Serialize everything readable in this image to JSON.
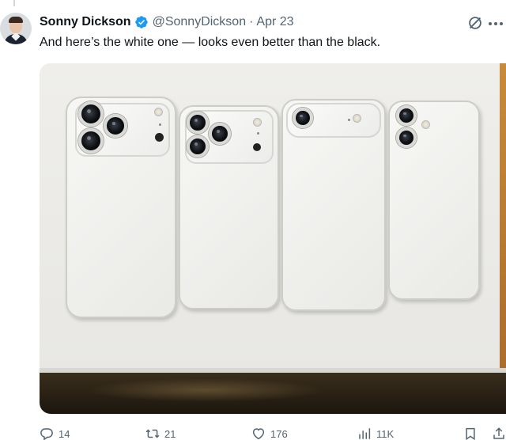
{
  "author": {
    "display_name": "Sonny Dickson",
    "handle": "@SonnyDickson",
    "separator": "·",
    "date": "Apr 23",
    "verified": true
  },
  "tweet": {
    "text": "And here’s the white one — looks even better than the black."
  },
  "media": {
    "image_description_icon": "photo-of-four-white-phone-dummies"
  },
  "actions": {
    "replies": "14",
    "reposts": "21",
    "likes": "176",
    "views": "11K"
  },
  "icons": {
    "grok": "grok-icon",
    "more": "more-icon",
    "reply": "reply-icon",
    "repost": "repost-icon",
    "like": "heart-icon",
    "views": "views-icon",
    "bookmark": "bookmark-icon"
  },
  "colors": {
    "verified_blue": "#1d9bf0",
    "text_primary": "#0f1419",
    "text_secondary": "#536471"
  }
}
